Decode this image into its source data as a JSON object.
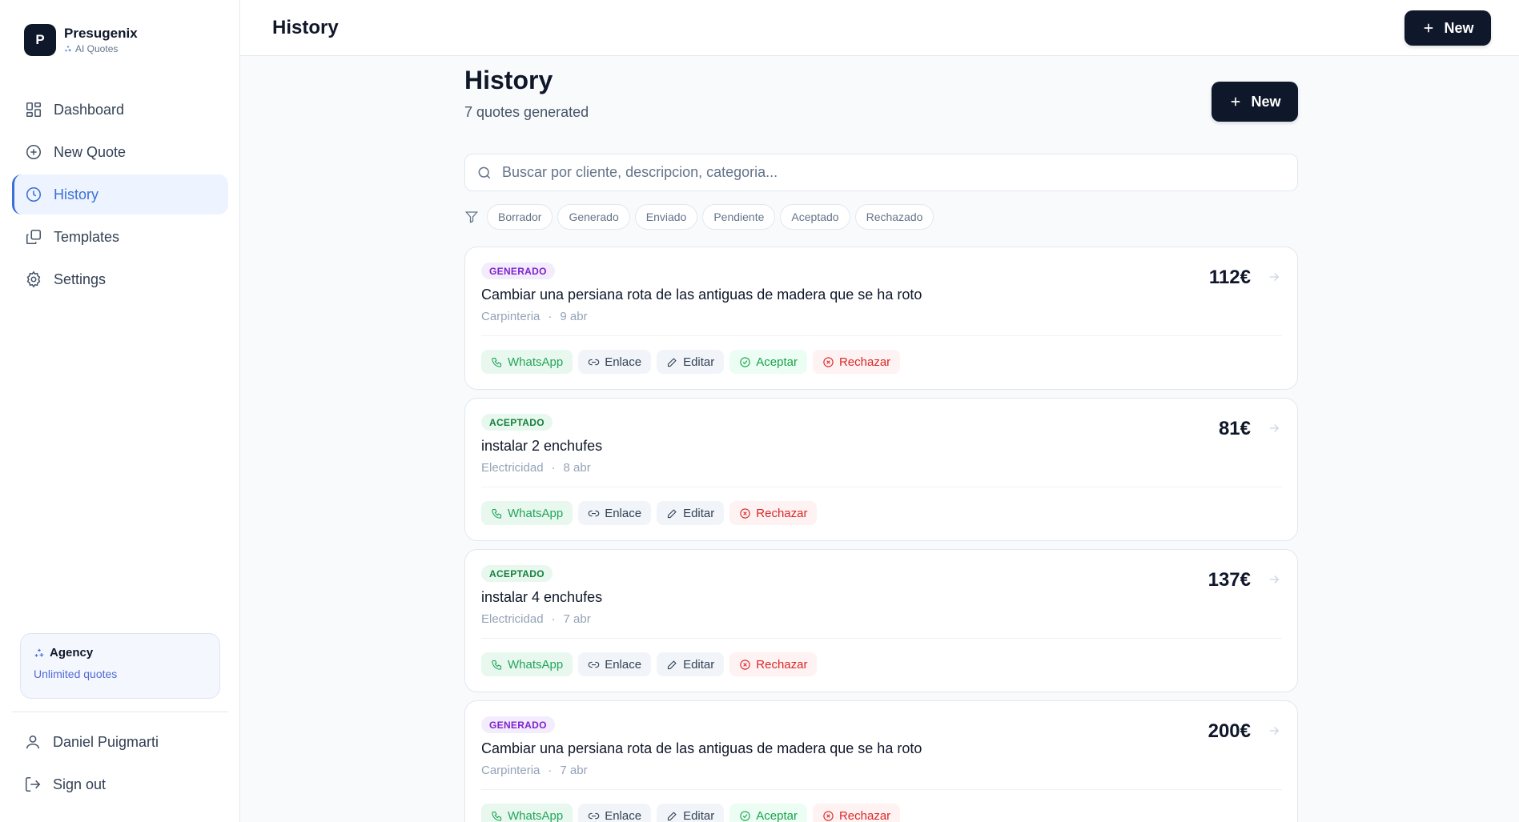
{
  "brand": {
    "logo_letter": "P",
    "name": "Presugenix",
    "subtitle": "AI Quotes"
  },
  "sidebar": {
    "items": [
      {
        "label": "Dashboard",
        "icon": "grid-icon"
      },
      {
        "label": "New Quote",
        "icon": "plus-circle-icon"
      },
      {
        "label": "History",
        "icon": "clock-icon",
        "active": true
      },
      {
        "label": "Templates",
        "icon": "copy-icon"
      },
      {
        "label": "Settings",
        "icon": "gear-icon"
      }
    ],
    "plan": {
      "title": "Agency",
      "subtitle": "Unlimited quotes"
    },
    "user_name": "Daniel Puigmarti",
    "signout_label": "Sign out"
  },
  "topbar": {
    "title": "History",
    "new_label": "New"
  },
  "main": {
    "title": "History",
    "subtitle": "7 quotes generated",
    "new_label": "New",
    "search_placeholder": "Buscar por cliente, descripcion, categoria...",
    "filters": [
      "Borrador",
      "Generado",
      "Enviado",
      "Pendiente",
      "Aceptado",
      "Rechazado"
    ]
  },
  "quotes": [
    {
      "status": "GENERADO",
      "title": "Cambiar una persiana rota de las antiguas de madera que se ha roto",
      "category": "Carpinteria",
      "date": "9 abr",
      "price": "112€",
      "actions": {
        "whatsapp": "WhatsApp",
        "link": "Enlace",
        "edit": "Editar",
        "accept": "Aceptar",
        "reject": "Rechazar"
      }
    },
    {
      "status": "ACEPTADO",
      "title": "instalar 2 enchufes",
      "category": "Electricidad",
      "date": "8 abr",
      "price": "81€",
      "actions": {
        "whatsapp": "WhatsApp",
        "link": "Enlace",
        "edit": "Editar",
        "reject": "Rechazar"
      }
    },
    {
      "status": "ACEPTADO",
      "title": "instalar 4 enchufes",
      "category": "Electricidad",
      "date": "7 abr",
      "price": "137€",
      "actions": {
        "whatsapp": "WhatsApp",
        "link": "Enlace",
        "edit": "Editar",
        "reject": "Rechazar"
      }
    },
    {
      "status": "GENERADO",
      "title": "Cambiar una persiana rota de las antiguas de madera que se ha roto",
      "category": "Carpinteria",
      "date": "7 abr",
      "price": "200€",
      "actions": {
        "whatsapp": "WhatsApp",
        "link": "Enlace",
        "edit": "Editar",
        "accept": "Aceptar",
        "reject": "Rechazar"
      }
    }
  ],
  "colors": {
    "primary": "#0f172a",
    "accent": "#3b6fd8",
    "whatsapp": "#22a55a",
    "accept": "#16a34a",
    "reject": "#dc2626",
    "generado": "#7e22ce",
    "aceptado": "#15803d"
  }
}
